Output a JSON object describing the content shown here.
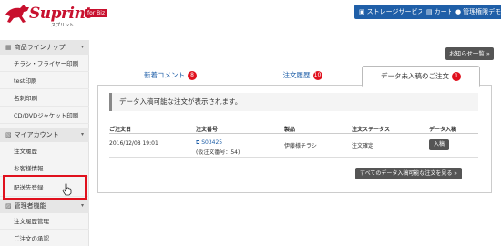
{
  "header": {
    "logo_text": "Suprint",
    "logo_badge": "for Biz",
    "logo_sub": "スプリント",
    "buttons": [
      {
        "label": "ストレージサービス",
        "icon": "storage-icon"
      },
      {
        "label": "カート",
        "icon": "cart-icon"
      },
      {
        "label": "管理権限デモ",
        "icon": "user-icon"
      }
    ]
  },
  "sidebar": {
    "sections": [
      {
        "label": "商品ラインナップ",
        "icon": "catalog-icon"
      },
      {
        "label": "マイアカウント",
        "icon": "account-icon"
      },
      {
        "label": "管理者機能",
        "icon": "admin-icon"
      }
    ],
    "items": [
      "チラシ・フライヤー印刷",
      "test印刷",
      "名刺印刷",
      "CD/DVDジャケット印刷",
      "注文履歴",
      "お客様情報",
      "配送先登録",
      "注文履歴管理",
      "ご注文の承認"
    ]
  },
  "main": {
    "notice_button": "お知らせ一覧 »",
    "tabs": [
      {
        "label": "新着コメント",
        "count": "8"
      },
      {
        "label": "注文履歴",
        "count": "10"
      },
      {
        "label": "データ未入稿のご注文",
        "count": "1"
      }
    ],
    "alert": "データ入稿可能な注文が表示されます。",
    "table": {
      "headers": [
        "ご注文日",
        "注文番号",
        "製品",
        "注文ステータス",
        "データ入稿"
      ],
      "rows": [
        {
          "date": "2016/12/08 19:01",
          "order_no": "S03425",
          "temp_no": "(仮注文番号：54)",
          "product": "伊藤様チラシ",
          "status": "注文確定",
          "action": "入稿"
        }
      ]
    },
    "all_button": "すべてのデータ入稿可能な注文を見る »"
  },
  "colors": {
    "brand_red": "#c8102e",
    "header_blue": "#1f5fa8",
    "badge_red": "#e0101d",
    "dark_button": "#555555"
  }
}
